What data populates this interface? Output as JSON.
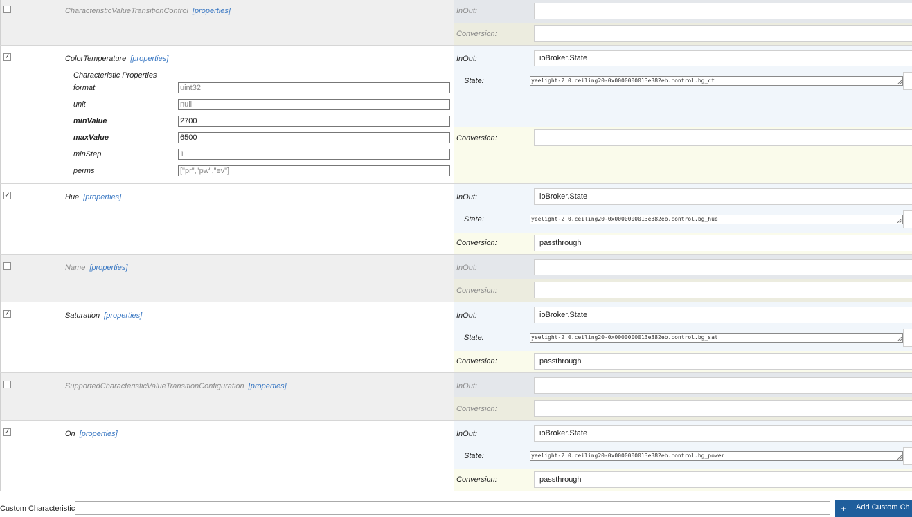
{
  "characteristics": {
    "transition_control": {
      "name": "CharacteristicValueTransitionControl",
      "properties_link": "[properties]",
      "inout_label": "InOut:",
      "inout_value": "",
      "conversion_label": "Conversion:",
      "conversion_value": ""
    },
    "color_temperature": {
      "name": "ColorTemperature",
      "properties_link": "[properties]",
      "props_heading": "Characteristic Properties",
      "props": [
        {
          "label": "format",
          "value": "uint32"
        },
        {
          "label": "unit",
          "value": "null"
        },
        {
          "label": "minValue",
          "value": "2700"
        },
        {
          "label": "maxValue",
          "value": "6500"
        },
        {
          "label": "minStep",
          "value": "1"
        },
        {
          "label": "perms",
          "value": "[\"pr\",\"pw\",\"ev\"]"
        }
      ],
      "inout_label": "InOut:",
      "inout_value": "ioBroker.State",
      "state_label": "State:",
      "state_value": "yeelight-2.0.ceiling20-0x0000000013e382eb.control.bg_ct",
      "conversion_label": "Conversion:",
      "conversion_value": ""
    },
    "hue": {
      "name": "Hue",
      "properties_link": "[properties]",
      "inout_label": "InOut:",
      "inout_value": "ioBroker.State",
      "state_label": "State:",
      "state_value": "yeelight-2.0.ceiling20-0x0000000013e382eb.control.bg_hue",
      "conversion_label": "Conversion:",
      "conversion_value": "passthrough"
    },
    "name": {
      "name": "Name",
      "properties_link": "[properties]",
      "inout_label": "InOut:",
      "inout_value": "",
      "conversion_label": "Conversion:",
      "conversion_value": ""
    },
    "saturation": {
      "name": "Saturation",
      "properties_link": "[properties]",
      "inout_label": "InOut:",
      "inout_value": "ioBroker.State",
      "state_label": "State:",
      "state_value": "yeelight-2.0.ceiling20-0x0000000013e382eb.control.bg_sat",
      "conversion_label": "Conversion:",
      "conversion_value": "passthrough"
    },
    "transition_config": {
      "name": "SupportedCharacteristicValueTransitionConfiguration",
      "properties_link": "[properties]",
      "inout_label": "InOut:",
      "inout_value": "",
      "conversion_label": "Conversion:",
      "conversion_value": ""
    },
    "on": {
      "name": "On",
      "properties_link": "[properties]",
      "inout_label": "InOut:",
      "inout_value": "ioBroker.State",
      "state_label": "State:",
      "state_value": "yeelight-2.0.ceiling20-0x0000000013e382eb.control.bg_power",
      "conversion_label": "Conversion:",
      "conversion_value": "passthrough"
    }
  },
  "footer": {
    "label": "Custom Characteristic",
    "add_button": "Add Custom Ch"
  }
}
